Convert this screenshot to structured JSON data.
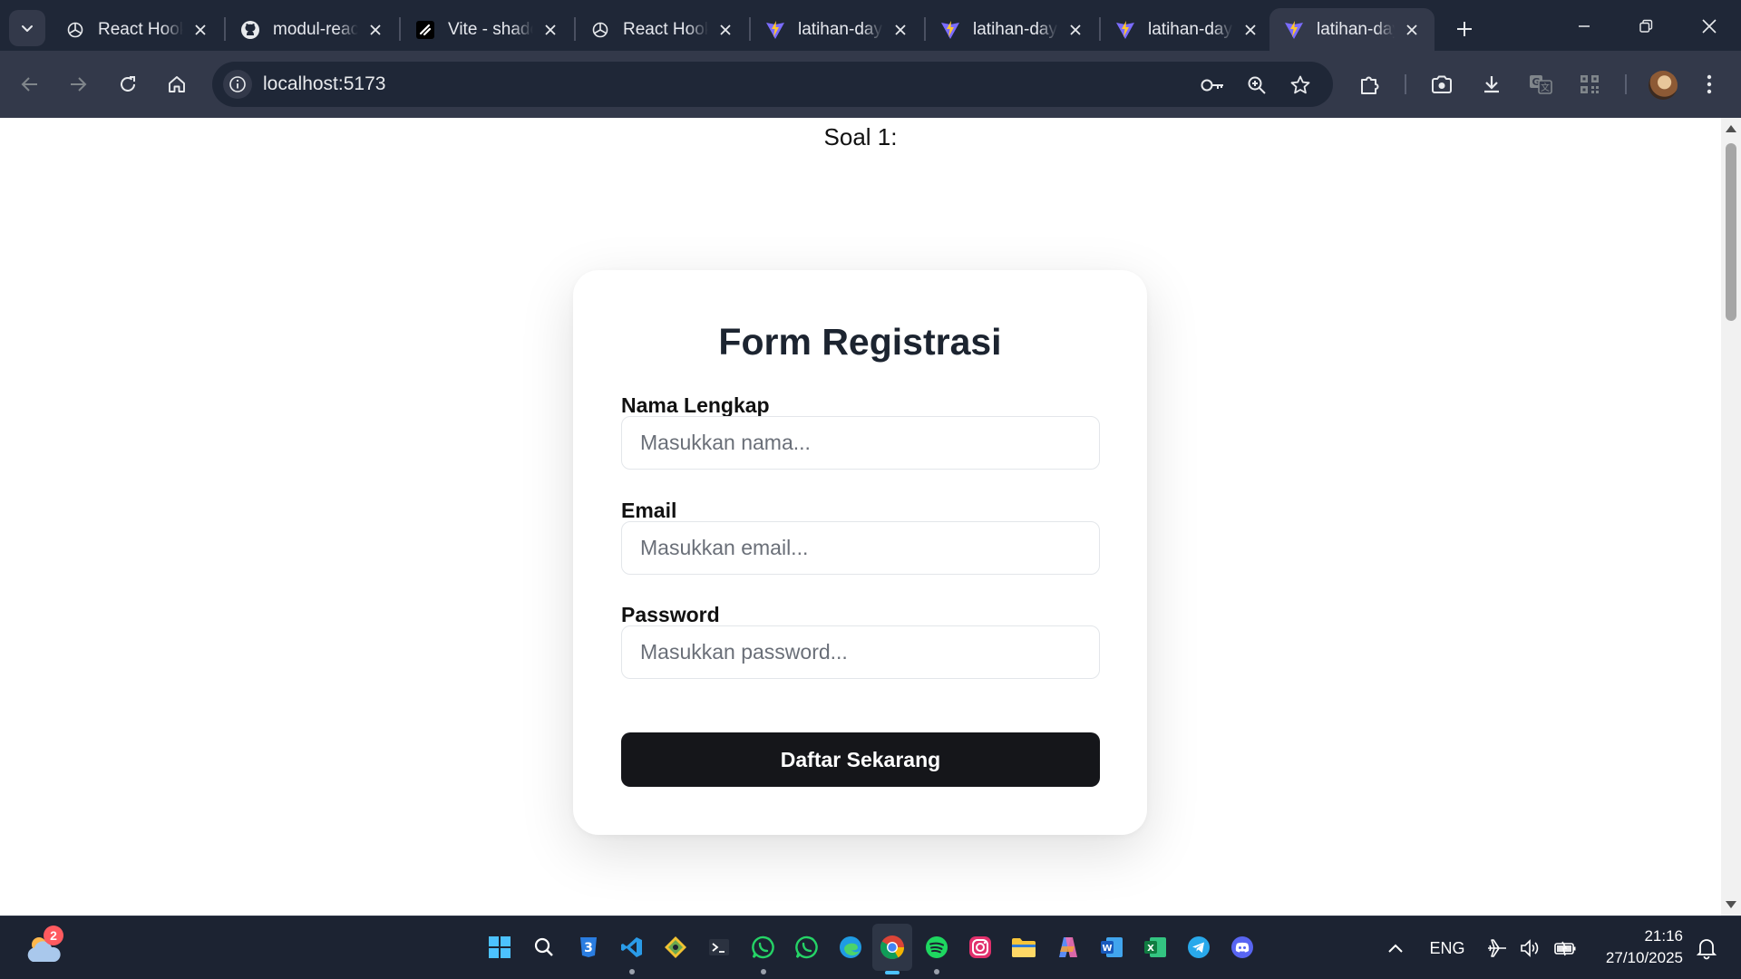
{
  "browser": {
    "tabs": [
      {
        "title": "React Hooks",
        "icon": "openai-icon",
        "active": false
      },
      {
        "title": "modul-react",
        "icon": "github-icon",
        "active": false
      },
      {
        "title": "Vite - shadcn",
        "icon": "shadcn-icon",
        "active": false
      },
      {
        "title": "React Hooks",
        "icon": "openai-icon",
        "active": false
      },
      {
        "title": "latihan-day",
        "icon": "vite-icon",
        "active": false
      },
      {
        "title": "latihan-day",
        "icon": "vite-icon",
        "active": false
      },
      {
        "title": "latihan-day",
        "icon": "vite-icon",
        "active": false
      },
      {
        "title": "latihan-day",
        "icon": "vite-icon",
        "active": true
      }
    ],
    "url": "localhost:5173",
    "accent": "#33394a"
  },
  "page": {
    "heading": "Soal 1:",
    "form": {
      "title": "Form Registrasi",
      "fields": [
        {
          "label": "Nama Lengkap",
          "placeholder": "Masukkan nama...",
          "value": ""
        },
        {
          "label": "Email",
          "placeholder": "Masukkan email...",
          "value": ""
        },
        {
          "label": "Password",
          "placeholder": "Masukkan password...",
          "value": ""
        }
      ],
      "submit_label": "Daftar Sekarang",
      "button_color": "#15161a"
    }
  },
  "taskbar": {
    "weather_badge": "2",
    "apps": [
      "windows-start-icon",
      "search-icon",
      "app-3-icon",
      "vscode-icon",
      "git-icon",
      "terminal-icon",
      "whatsapp-icon",
      "whatsapp-icon",
      "edge-icon",
      "chrome-icon",
      "spotify-icon",
      "instagram-icon",
      "file-explorer-icon",
      "copilot-icon",
      "word-icon",
      "excel-icon",
      "telegram-icon",
      "discord-icon"
    ],
    "language": "ENG",
    "time": "21:16",
    "date": "27/10/2025"
  }
}
